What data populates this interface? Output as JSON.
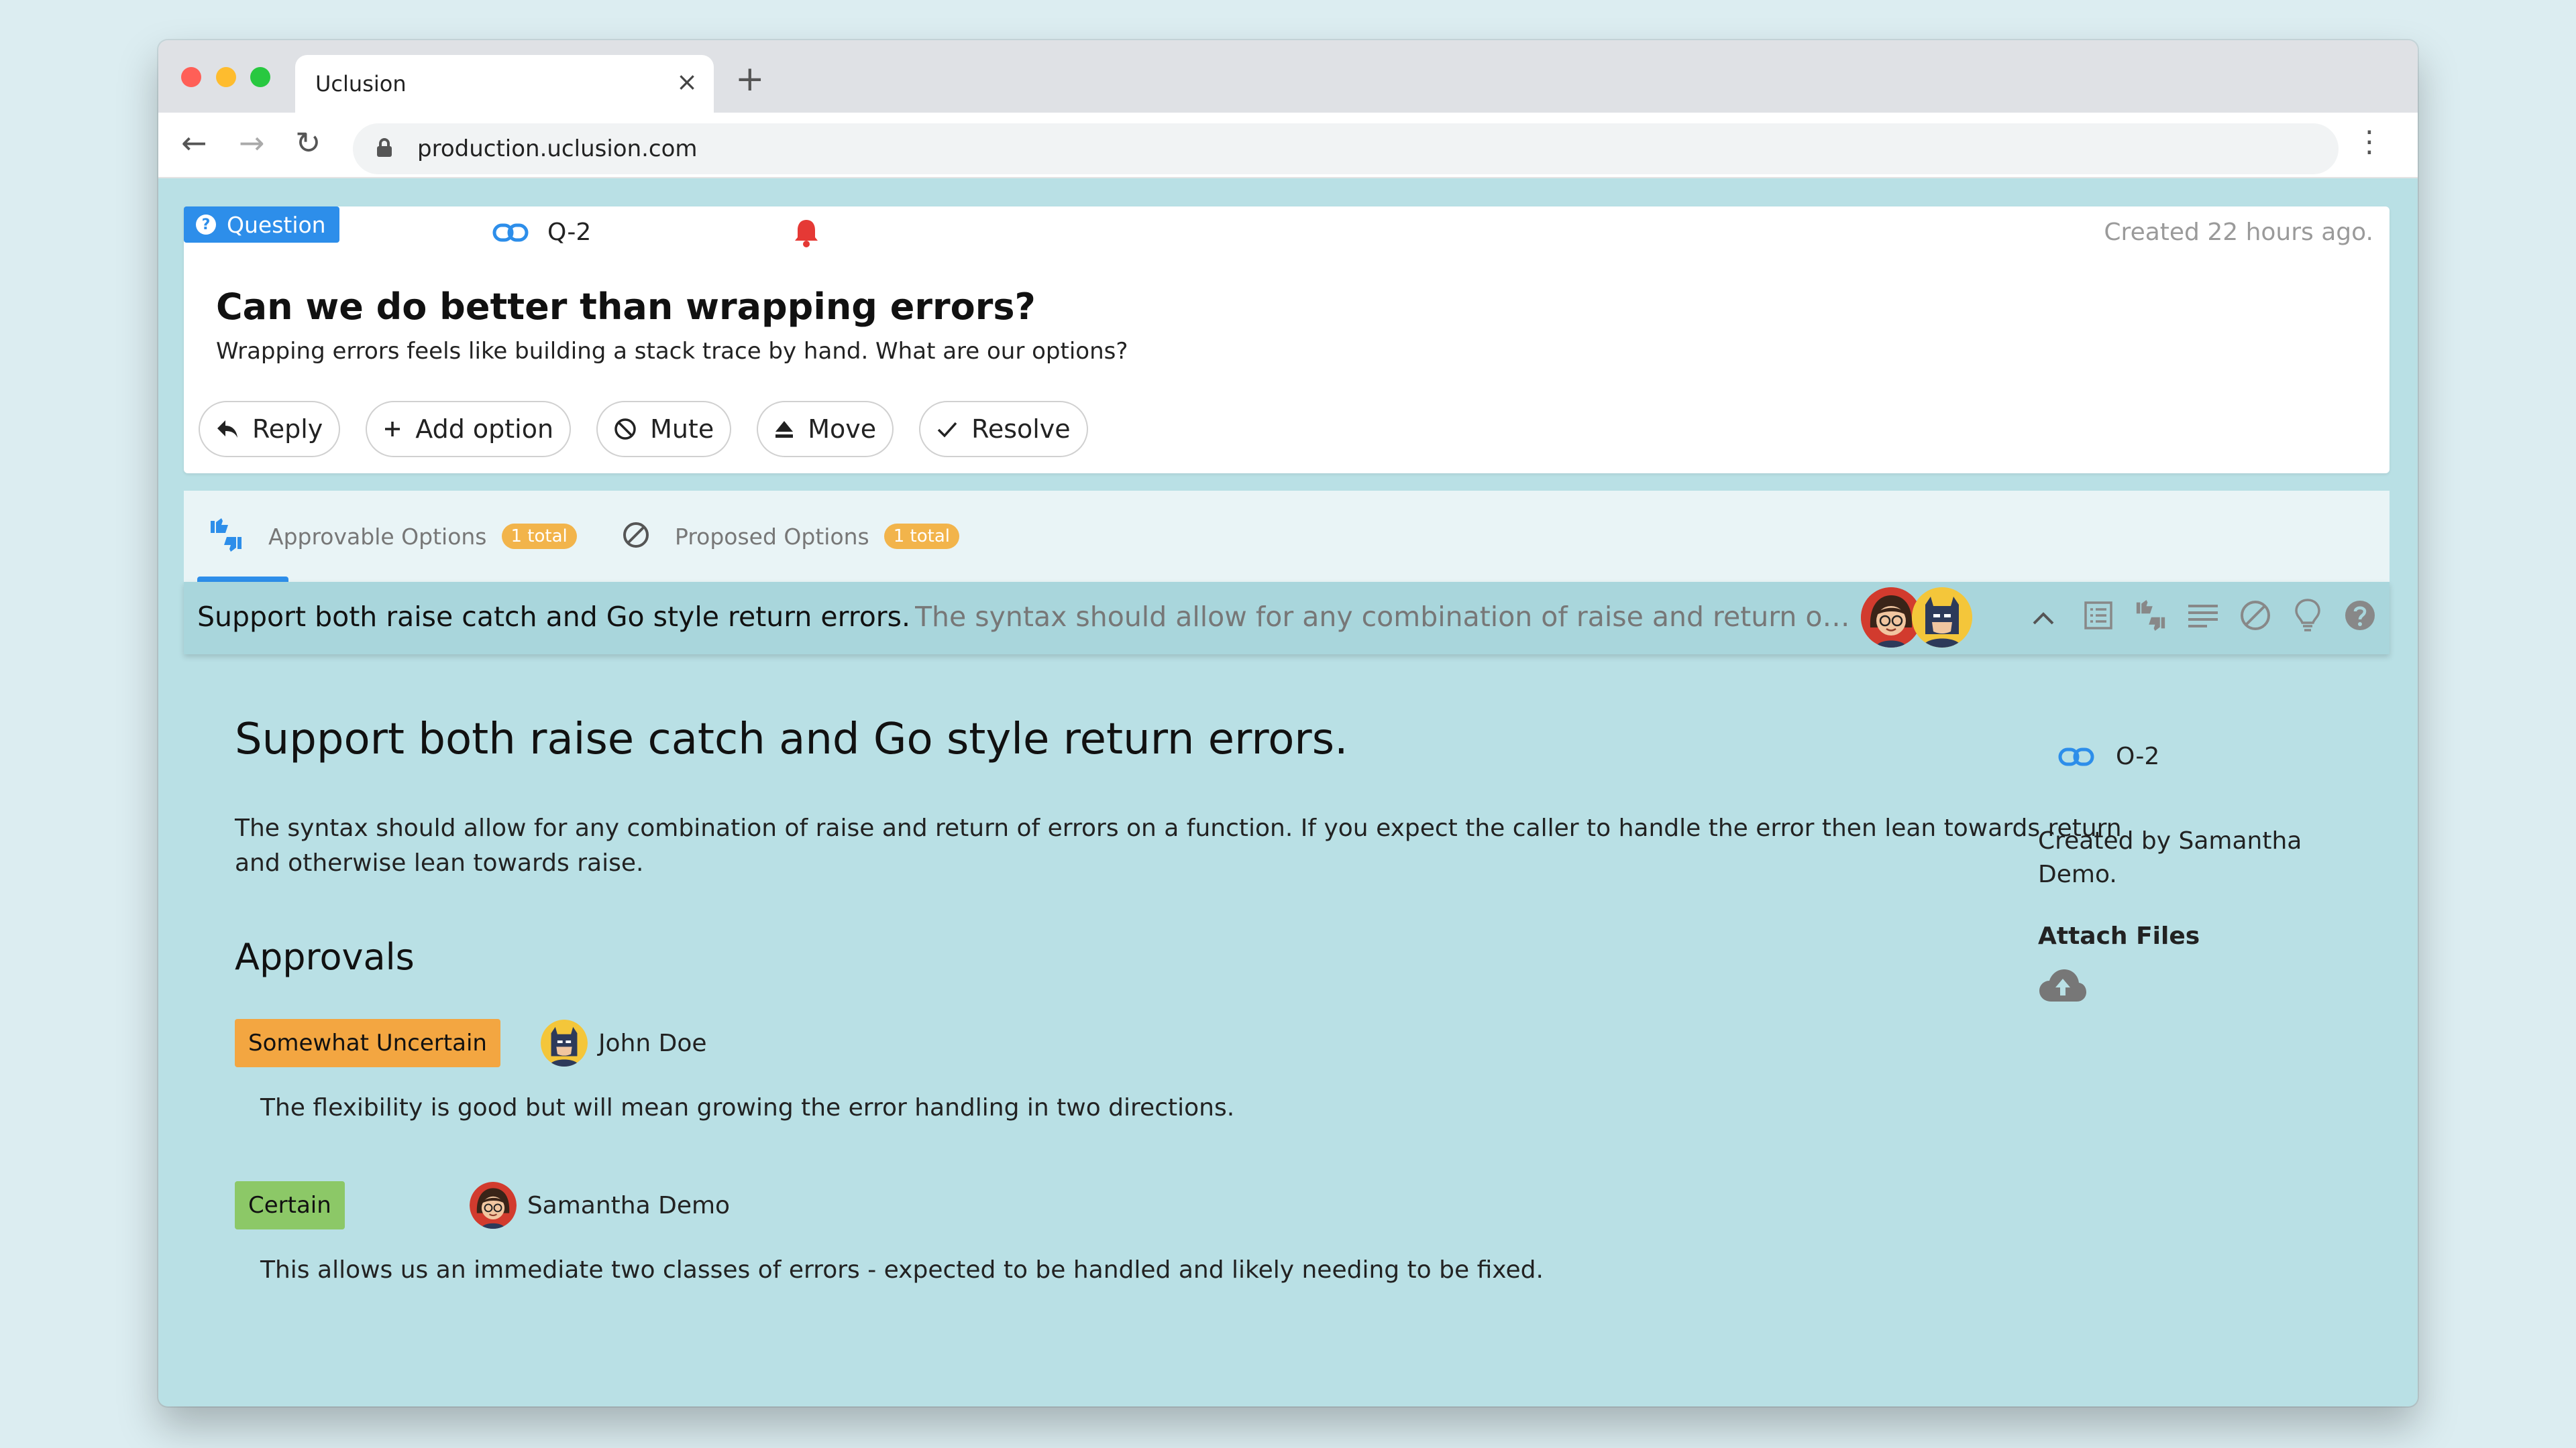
{
  "browser": {
    "tab_title": "Uclusion",
    "tab_close": "×",
    "new_tab": "+",
    "url": "production.uclusion.com",
    "back": "←",
    "forward": "→",
    "reload": "↻",
    "menu": "⋮"
  },
  "question": {
    "badge": "Question",
    "id": "Q-2",
    "created": "Created 22 hours ago.",
    "title": "Can we do better than wrapping errors?",
    "description": "Wrapping errors feels like building a stack trace by hand. What are our options?",
    "actions": {
      "reply": "Reply",
      "add_option": "Add option",
      "mute": "Mute",
      "move": "Move",
      "resolve": "Resolve"
    }
  },
  "tabs": [
    {
      "label": "Approvable Options",
      "count": "1 total",
      "icon": "thumbs-up-down-icon"
    },
    {
      "label": "Proposed Options",
      "count": "1 total",
      "icon": "block-icon"
    }
  ],
  "option_row": {
    "title": "Support both raise catch and Go style return errors.",
    "snippet": "The syntax should allow for any combination of raise and return of errors on a function.",
    "collapse": "^"
  },
  "option": {
    "title": "Support both raise catch and Go style return errors.",
    "description": "The syntax should allow for any combination of raise and return of errors on a function. If you expect the caller to handle the error then lean towards return and otherwise lean towards raise.",
    "id": "O-2",
    "created_by": "Created by Samantha Demo.",
    "attach_files": "Attach Files",
    "approvals_heading": "Approvals",
    "approvals": [
      {
        "certainty": "Somewhat Uncertain",
        "name": "John Doe",
        "comment": "The flexibility is good but will mean growing the error handling in two directions.",
        "color": "#f3a641"
      },
      {
        "certainty": "Certain",
        "name": "Samantha Demo",
        "comment": "This allows us an immediate two classes of errors - expected to be handled and likely needing to be fixed.",
        "color": "#8cc867"
      }
    ]
  },
  "colors": {
    "accent": "#2d8eea",
    "background": "#b9e0e5",
    "pill": "#f2b44b",
    "bell": "#e53935"
  }
}
